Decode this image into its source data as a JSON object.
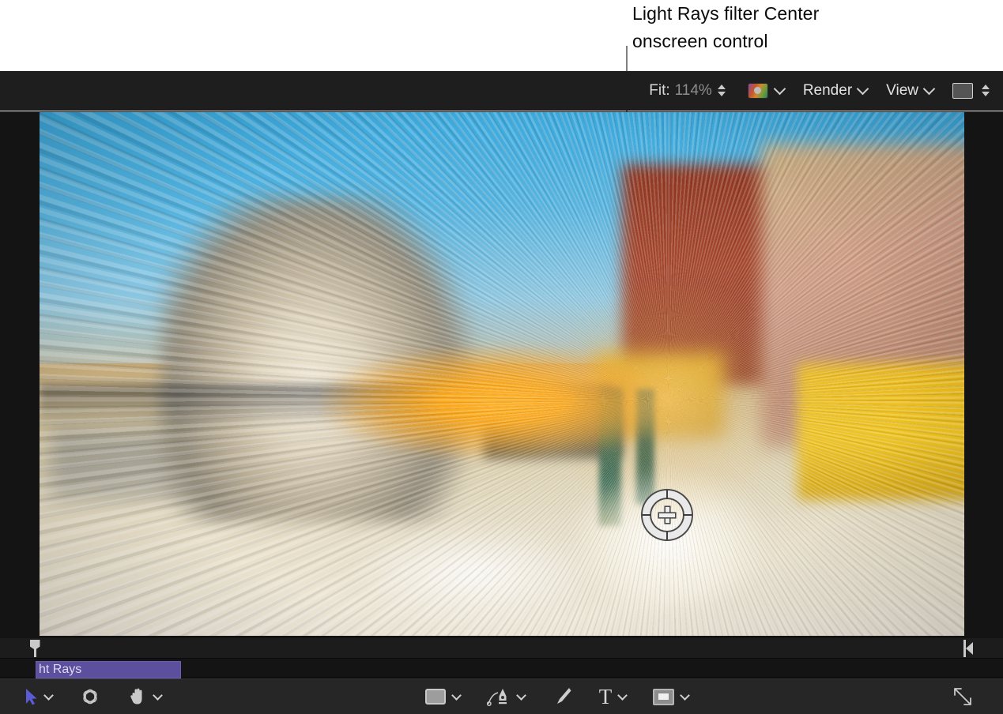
{
  "callout": {
    "text": "Light Rays filter Center\nonscreen control",
    "line_color": "#808080"
  },
  "top_toolbar": {
    "fit_label": "Fit:",
    "fit_value": "114%",
    "fit_stepper_icon": "stepper-up-down-icon",
    "color_swatch_icon": "color-gradient-swatch-icon",
    "color_chevron_icon": "chevron-down-icon",
    "render_menu": "Render",
    "render_chevron_icon": "chevron-down-icon",
    "view_menu": "View",
    "view_chevron_icon": "chevron-down-icon",
    "background_swatch_icon": "background-square-icon",
    "background_stepper_icon": "stepper-up-down-icon",
    "background_color": "#555555"
  },
  "canvas": {
    "viewer_label": "canvas-viewer",
    "onscreen_control": {
      "name": "light-rays-center-control",
      "ring_color": "#e9e9e9",
      "notch_color": "#3c3c3c",
      "center_icon": "plus-crosshair-icon"
    }
  },
  "timeline": {
    "playhead_icon": "playhead-marker-icon",
    "outpoint_icon": "out-point-marker-icon",
    "clip_label": "ht Rays",
    "clip_color": "#5b4f9e"
  },
  "bottom_toolbar": {
    "tools": [
      {
        "name": "select-arrow-tool",
        "icon": "arrow-cursor-icon",
        "has_chevron": true
      },
      {
        "name": "orbit-3d-tool",
        "icon": "orbit-3d-icon",
        "has_chevron": false
      },
      {
        "name": "pan-hand-tool",
        "icon": "hand-icon",
        "has_chevron": true
      },
      {
        "name": "shape-rectangle-tool",
        "icon": "rectangle-shape-icon",
        "has_chevron": true
      },
      {
        "name": "bezier-pen-tool",
        "icon": "pen-nib-icon",
        "has_chevron": true
      },
      {
        "name": "paint-brush-tool",
        "icon": "paint-brush-icon",
        "has_chevron": false
      },
      {
        "name": "text-tool",
        "icon": "text-t-icon",
        "label": "T",
        "has_chevron": true
      },
      {
        "name": "mask-tool",
        "icon": "mask-frame-icon",
        "has_chevron": true
      },
      {
        "name": "resize-view-control",
        "icon": "diagonal-resize-arrow-icon",
        "has_chevron": false
      }
    ],
    "text_tool_glyph": "T"
  }
}
